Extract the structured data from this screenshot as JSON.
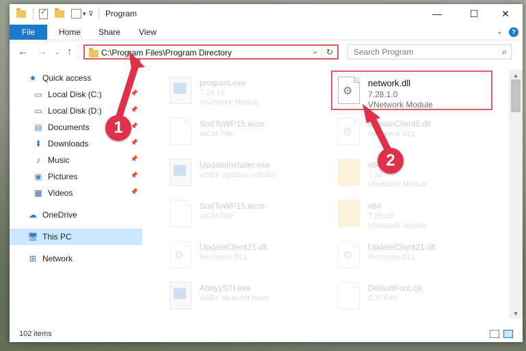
{
  "window": {
    "title": "Program",
    "controls": {
      "minimize": "—",
      "maximize": "☐",
      "close": "✕"
    }
  },
  "ribbon": {
    "tabs": [
      "File",
      "Home",
      "Share",
      "View"
    ],
    "help_icon": "?"
  },
  "navbar": {
    "address": "C:\\Program Files\\Program Directory",
    "search_placeholder": "Search Program"
  },
  "sidebar": {
    "items": [
      {
        "label": "Quick access",
        "icon": "star-icon"
      },
      {
        "label": "Local Disk (C:)",
        "icon": "drive-icon",
        "pinned": true
      },
      {
        "label": "Local Disk (D:)",
        "icon": "drive-icon",
        "pinned": true
      },
      {
        "label": "Documents",
        "icon": "documents-icon",
        "pinned": true
      },
      {
        "label": "Downloads",
        "icon": "downloads-icon",
        "pinned": true
      },
      {
        "label": "Music",
        "icon": "music-icon",
        "pinned": true
      },
      {
        "label": "Pictures",
        "icon": "pictures-icon",
        "pinned": true
      },
      {
        "label": "Videos",
        "icon": "videos-icon",
        "pinned": true
      },
      {
        "label": "OneDrive",
        "icon": "cloud-icon"
      },
      {
        "label": "This PC",
        "icon": "computer-icon",
        "selected": true
      },
      {
        "label": "Network",
        "icon": "network-icon"
      }
    ]
  },
  "files": {
    "left": [
      {
        "name": "program.exe",
        "line2": "7.28.10",
        "line3": "VNetwork Module",
        "icon": "exe"
      },
      {
        "name": "SndToWP15.wcm",
        "line2": "WCM File",
        "line3": "",
        "icon": "page"
      },
      {
        "name": "UpdateInstaller.exe",
        "line2": "ABBY updates installer",
        "line3": "",
        "icon": "exe"
      },
      {
        "name": "SndToWP15.wcm",
        "line2": "WCM File",
        "line3": "",
        "icon": "page"
      },
      {
        "name": "UpdateClient21.dll",
        "line2": "Resource DLL",
        "line3": "",
        "icon": "gear"
      },
      {
        "name": "AbbyySTI.exe",
        "line2": "ABBY sti event hand",
        "line3": "",
        "icon": "exe"
      }
    ],
    "right": [
      {
        "name": "network.dll",
        "line2": "7.28.1.0",
        "line3": "VNetwork Module",
        "icon": "gear",
        "highlighted": true
      },
      {
        "name": "UpdateClient5.dll",
        "line2": "Resource DLL",
        "line3": "",
        "icon": "gear"
      },
      {
        "name": "x64",
        "line2": "7.28",
        "line3": "VNetwork Module",
        "icon": "folder"
      },
      {
        "name": "x64",
        "line2": "7.28.10",
        "line3": "VNetwork Module",
        "icon": "folder"
      },
      {
        "name": "UpdateClient21.dll",
        "line2": "Resource DLL",
        "line3": "",
        "icon": "gear"
      },
      {
        "name": "DefaultFont.cjk",
        "line2": "CJK File",
        "line3": "",
        "icon": "page"
      }
    ]
  },
  "status": {
    "item_count": "102 items"
  },
  "annotations": {
    "step1": "1",
    "step2": "2",
    "color": "#e0314a"
  }
}
